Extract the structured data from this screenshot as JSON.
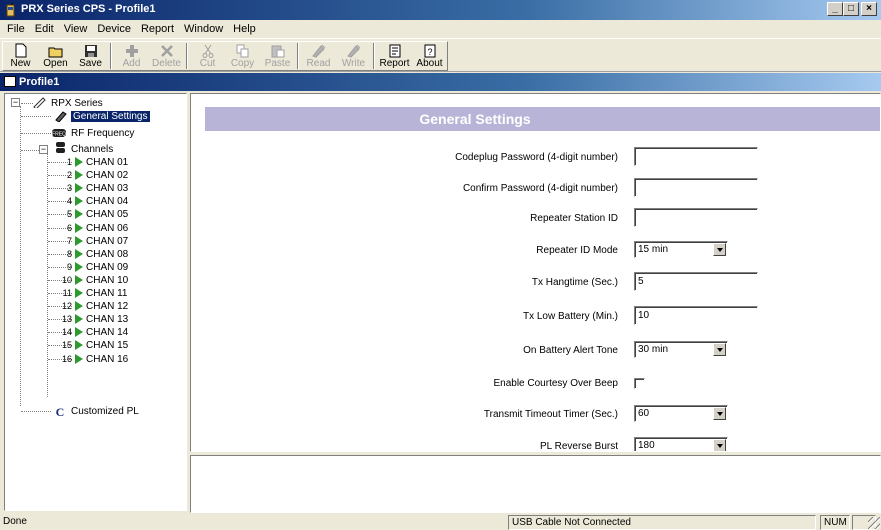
{
  "window": {
    "title": "PRX Series CPS - Profile1",
    "minimize": "_",
    "maximize": "□",
    "close": "×"
  },
  "menu": [
    "File",
    "Edit",
    "View",
    "Device",
    "Report",
    "Window",
    "Help"
  ],
  "toolbar": [
    {
      "label": "New",
      "icon": "new-document-icon",
      "enabled": true
    },
    {
      "label": "Open",
      "icon": "open-folder-icon",
      "enabled": true
    },
    {
      "label": "Save",
      "icon": "save-disk-icon",
      "enabled": true
    },
    {
      "label": "Add",
      "icon": "add-icon",
      "enabled": false
    },
    {
      "label": "Delete",
      "icon": "delete-icon",
      "enabled": false
    },
    {
      "label": "Cut",
      "icon": "cut-icon",
      "enabled": false
    },
    {
      "label": "Copy",
      "icon": "copy-icon",
      "enabled": false
    },
    {
      "label": "Paste",
      "icon": "paste-icon",
      "enabled": false
    },
    {
      "label": "Read",
      "icon": "read-radio-icon",
      "enabled": false
    },
    {
      "label": "Write",
      "icon": "write-radio-icon",
      "enabled": false
    },
    {
      "label": "Report",
      "icon": "report-icon",
      "enabled": true
    },
    {
      "label": "About",
      "icon": "about-icon",
      "enabled": true
    }
  ],
  "document": {
    "title": "Profile1"
  },
  "tree": {
    "root": "RPX Series",
    "general_settings": "General Settings",
    "rf_frequency": "RF Frequency",
    "channels": "Channels",
    "channel_items": [
      {
        "num": "1",
        "label": "CHAN 01"
      },
      {
        "num": "2",
        "label": "CHAN 02"
      },
      {
        "num": "3",
        "label": "CHAN 03"
      },
      {
        "num": "4",
        "label": "CHAN 04"
      },
      {
        "num": "5",
        "label": "CHAN 05"
      },
      {
        "num": "6",
        "label": "CHAN 06"
      },
      {
        "num": "7",
        "label": "CHAN 07"
      },
      {
        "num": "8",
        "label": "CHAN 08"
      },
      {
        "num": "9",
        "label": "CHAN 09"
      },
      {
        "num": "10",
        "label": "CHAN 10"
      },
      {
        "num": "11",
        "label": "CHAN 11"
      },
      {
        "num": "12",
        "label": "CHAN 12"
      },
      {
        "num": "13",
        "label": "CHAN 13"
      },
      {
        "num": "14",
        "label": "CHAN 14"
      },
      {
        "num": "15",
        "label": "CHAN 15"
      },
      {
        "num": "16",
        "label": "CHAN 16"
      }
    ],
    "customized_pl": "Customized PL"
  },
  "settings": {
    "header": "General Settings",
    "fields": [
      {
        "label": "Codeplug Password (4-digit number)",
        "type": "text",
        "value": ""
      },
      {
        "label": "Confirm Password (4-digit number)",
        "type": "text",
        "value": ""
      },
      {
        "label": "Repeater Station ID",
        "type": "text",
        "value": ""
      },
      {
        "label": "Repeater ID Mode",
        "type": "select",
        "value": "15 min"
      },
      {
        "label": "Tx Hangtime (Sec.)",
        "type": "text",
        "value": "5"
      },
      {
        "label": "Tx Low Battery (Min.)",
        "type": "text",
        "value": "10"
      },
      {
        "label": "On Battery Alert Tone",
        "type": "select",
        "value": "30 min"
      },
      {
        "label": "Enable Courtesy Over Beep",
        "type": "checkbox",
        "value": false
      },
      {
        "label": "Transmit Timeout Timer (Sec.)",
        "type": "select",
        "value": "60"
      },
      {
        "label": "PL Reverse Burst",
        "type": "select",
        "value": "180"
      }
    ]
  },
  "status": {
    "left": "Done",
    "connection": "USB Cable Not Connected",
    "num": "NUM"
  },
  "colors": {
    "title_gradient_start": "#0a246a",
    "header_band": "#b8b4d8",
    "channel_arrow": "#2e9a2e"
  }
}
